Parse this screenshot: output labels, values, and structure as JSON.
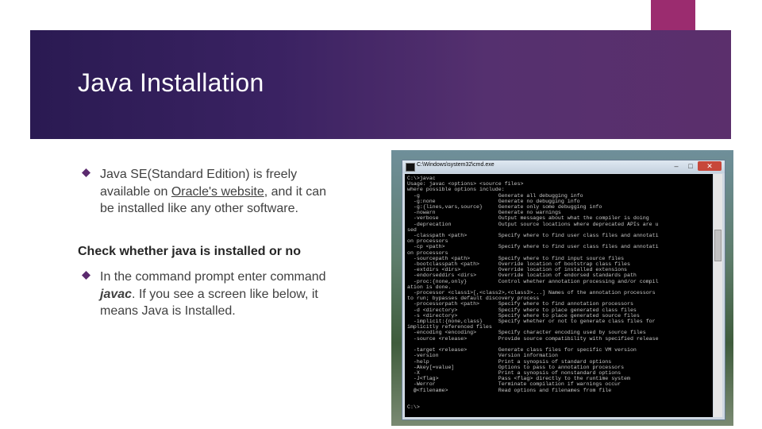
{
  "slide": {
    "title": "Java Installation",
    "bullet1_before": "Java SE(Standard Edition) is freely available on ",
    "bullet1_link": "Oracle's website",
    "bullet1_after": ", and it can be installed like any other software.",
    "heading": "Check whether java is installed or no",
    "bullet2_before": "In the command prompt enter command ",
    "bullet2_cmd": "javac",
    "bullet2_after": ". If you see a screen like below, it means Java is Installed.",
    "colors": {
      "accent": "#9b2c6f",
      "banner": "#3a2262",
      "bullet": "#5b2a6e"
    }
  },
  "screenshot": {
    "window_title": "C:\\Windows\\system32\\cmd.exe",
    "minimize_label": "–",
    "maximize_label": "□",
    "close_label": "✕",
    "console_text": "C:\\>javac\nUsage: javac <options> <source files>\nwhere possible options include:\n  -g                         Generate all debugging info\n  -g:none                    Generate no debugging info\n  -g:{lines,vars,source}     Generate only some debugging info\n  -nowarn                    Generate no warnings\n  -verbose                   Output messages about what the compiler is doing\n  -deprecation               Output source locations where deprecated APIs are u\nsed\n  -classpath <path>          Specify where to find user class files and annotati\non processors\n  -cp <path>                 Specify where to find user class files and annotati\non processors\n  -sourcepath <path>         Specify where to find input source files\n  -bootclasspath <path>      Override location of bootstrap class files\n  -extdirs <dirs>            Override location of installed extensions\n  -endorseddirs <dirs>       Override location of endorsed standards path\n  -proc:{none,only}          Control whether annotation processing and/or compil\nation is done.\n  -processor <class1>[,<class2>,<class3>...] Names of the annotation processors\nto run; bypasses default discovery process\n  -processorpath <path>      Specify where to find annotation processors\n  -d <directory>             Specify where to place generated class files\n  -s <directory>             Specify where to place generated source files\n  -implicit:{none,class}     Specify whether or not to generate class files for\nimplicitly referenced files\n  -encoding <encoding>       Specify character encoding used by source files\n  -source <release>          Provide source compatibility with specified release\n\n  -target <release>          Generate class files for specific VM version\n  -version                   Version information\n  -help                      Print a synopsis of standard options\n  -Akey[=value]              Options to pass to annotation processors\n  -X                         Print a synopsis of nonstandard options\n  -J<flag>                   Pass <flag> directly to the runtime system\n  -Werror                    Terminate compilation if warnings occur\n  @<filename>                Read options and filenames from file\n\n\nC:\\>"
  }
}
